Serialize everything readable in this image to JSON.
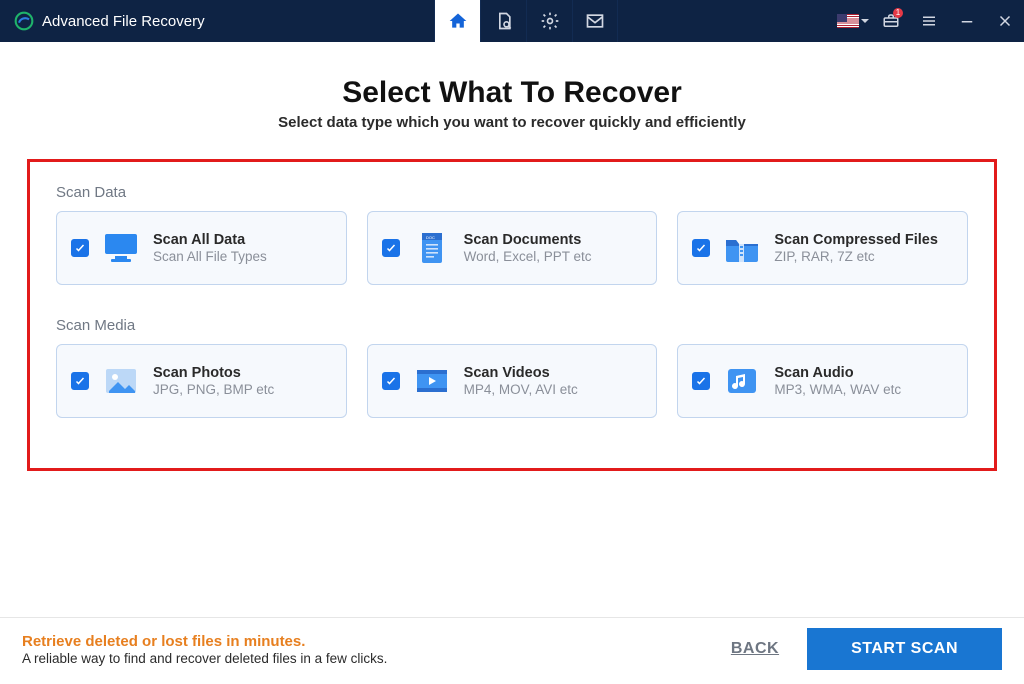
{
  "titlebar": {
    "app_name": "Advanced File Recovery",
    "toolbox_badge": "1"
  },
  "main": {
    "heading": "Select What To Recover",
    "subtitle": "Select data type which you want to recover quickly and efficiently",
    "sections": [
      {
        "title": "Scan Data",
        "cards": [
          {
            "title": "Scan All Data",
            "desc": "Scan All File Types"
          },
          {
            "title": "Scan Documents",
            "desc": "Word, Excel, PPT etc"
          },
          {
            "title": "Scan Compressed Files",
            "desc": "ZIP, RAR, 7Z etc"
          }
        ]
      },
      {
        "title": "Scan Media",
        "cards": [
          {
            "title": "Scan Photos",
            "desc": "JPG, PNG, BMP etc"
          },
          {
            "title": "Scan Videos",
            "desc": "MP4, MOV, AVI etc"
          },
          {
            "title": "Scan Audio",
            "desc": "MP3, WMA, WAV etc"
          }
        ]
      }
    ]
  },
  "footer": {
    "headline": "Retrieve deleted or lost files in minutes.",
    "subtext": "A reliable way to find and recover deleted files in a few clicks.",
    "back_label": "BACK",
    "start_label": "START SCAN"
  }
}
